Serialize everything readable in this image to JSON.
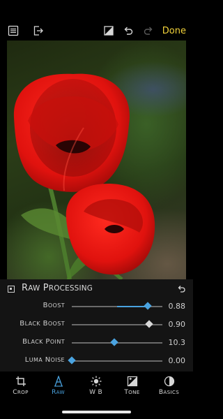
{
  "toolbar": {
    "left_icons": [
      "menu-list-icon",
      "export-icon"
    ],
    "right_icons": [
      "compare-icon",
      "undo-icon",
      "redo-icon"
    ],
    "done_label": "Done"
  },
  "photo": {
    "subject": "tulip-photo"
  },
  "panel": {
    "title": "Raw Processing",
    "enabled": true,
    "sliders": [
      {
        "label": "Boost",
        "value": "0.88",
        "fraction": 0.84,
        "fill": "center"
      },
      {
        "label": "Black Boost",
        "value": "0.90",
        "fraction": 0.85,
        "fill": "none"
      },
      {
        "label": "Black Point",
        "value": "10.3",
        "fraction": 0.47,
        "fill": "center"
      },
      {
        "label": "Luma Noise",
        "value": "0.00",
        "fraction": 0.0,
        "fill": "none"
      }
    ]
  },
  "tabs": [
    {
      "label": "Crop",
      "icon": "crop-icon",
      "active": false
    },
    {
      "label": "Raw",
      "icon": "raw-icon",
      "active": true
    },
    {
      "label": "W B",
      "icon": "sun-icon",
      "active": false
    },
    {
      "label": "Tone",
      "icon": "tone-icon",
      "active": false
    },
    {
      "label": "Basics",
      "icon": "contrast-icon",
      "active": false
    }
  ],
  "colors": {
    "accent": "#4aa3e0",
    "done": "#f2d23a",
    "background": "#000000",
    "panel": "#141414"
  }
}
